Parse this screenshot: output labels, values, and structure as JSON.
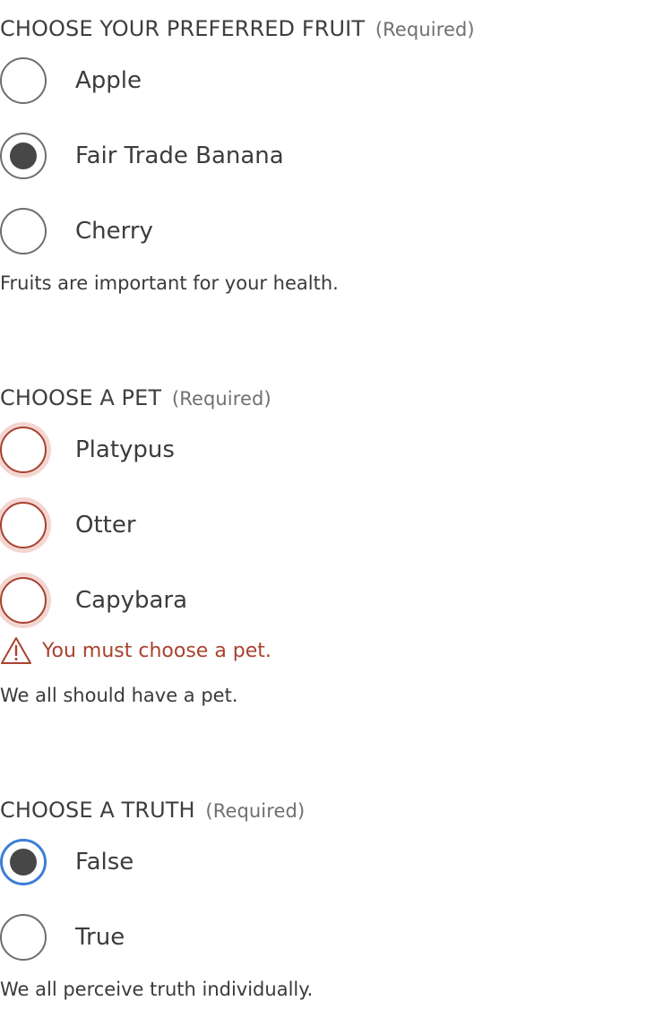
{
  "groups": [
    {
      "legend": "CHOOSE YOUR PREFERRED FRUIT",
      "required": "(Required)",
      "options": [
        {
          "label": "Apple",
          "checked": false
        },
        {
          "label": "Fair Trade Banana",
          "checked": true
        },
        {
          "label": "Cherry",
          "checked": false
        }
      ],
      "hint": "Fruits are important for your health."
    },
    {
      "legend": "CHOOSE A PET",
      "required": "(Required)",
      "options": [
        {
          "label": "Platypus",
          "checked": false
        },
        {
          "label": "Otter",
          "checked": false
        },
        {
          "label": "Capybara",
          "checked": false
        }
      ],
      "error": "You must choose a pet.",
      "error_icon": "warning-triangle-icon",
      "hint": "We all should have a pet."
    },
    {
      "legend": "CHOOSE A TRUTH",
      "required": "(Required)",
      "options": [
        {
          "label": "False",
          "checked": true,
          "focused": true
        },
        {
          "label": "True",
          "checked": false
        }
      ],
      "hint": "We all perceive truth individually."
    }
  ],
  "colors": {
    "error": "#a8422f",
    "error_halo": "#f3d6d1",
    "focus": "#3d7fd6",
    "radio_border": "#6e6e6e",
    "radio_dot": "#474747"
  }
}
